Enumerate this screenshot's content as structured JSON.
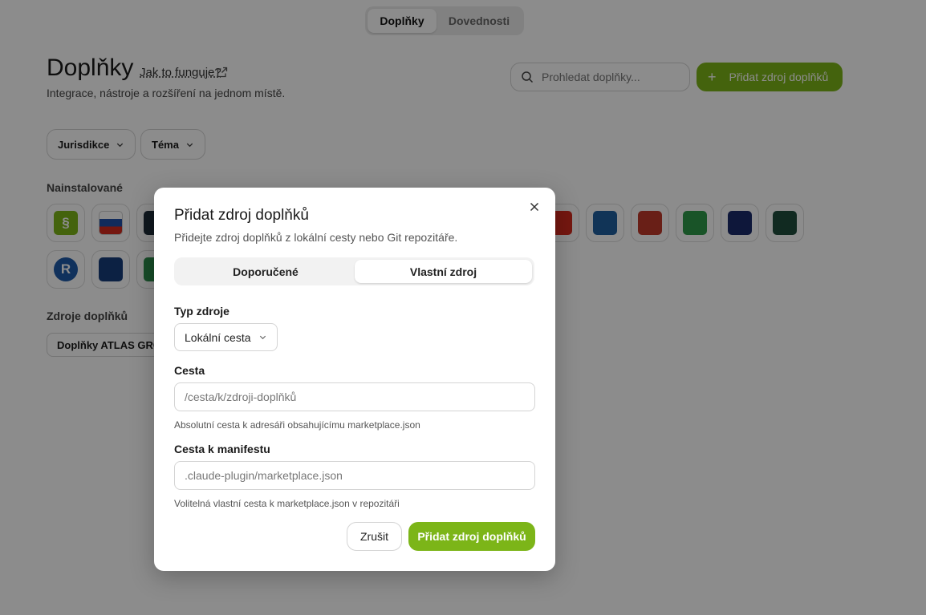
{
  "top_tabs": {
    "active": "Doplňky",
    "inactive": "Dovednosti"
  },
  "page": {
    "title": "Doplňky",
    "help_link": "Jak to funguje?",
    "subtitle": "Integrace, nástroje a rozšíření na jednom místě.",
    "search_placeholder": "Prohledat doplňky...",
    "add_source_label": "Přidat zdroj doplňků",
    "filters": {
      "jurisdiction": "Jurisdikce",
      "topic": "Téma"
    },
    "installed_label": "Nainstalované",
    "sources_label": "Zdroje doplňků",
    "source_chip": "Doplňky ATLAS GROUP"
  },
  "installed_icons": [
    {
      "name": "paragraph-icon",
      "glyph": "§",
      "color": "#7cb518"
    },
    {
      "name": "slovakia-flag-icon",
      "glyph": "",
      "color": "#ffffff"
    },
    {
      "name": "chart-icon",
      "glyph": "",
      "color": "#1e2d3a"
    },
    {
      "name": "flag-icon",
      "glyph": "",
      "color": "#d52b1e"
    },
    {
      "name": "bank-icon",
      "glyph": "",
      "color": "#1f5f9e"
    },
    {
      "name": "medical-house-icon",
      "glyph": "",
      "color": "#c0392b"
    },
    {
      "name": "map-pin-icon",
      "glyph": "",
      "color": "#2f9a4a"
    },
    {
      "name": "document-stamp-icon",
      "glyph": "",
      "color": "#1b2a6b"
    },
    {
      "name": "scales-search-icon",
      "glyph": "",
      "color": "#1f4e3d"
    },
    {
      "name": "registered-icon",
      "glyph": "",
      "color": "#1e5aa8"
    },
    {
      "name": "briefcase-icon",
      "glyph": "",
      "color": "#173d7a"
    },
    {
      "name": "green-app-icon",
      "glyph": "",
      "color": "#2a8a4a"
    }
  ],
  "dialog": {
    "title": "Přidat zdroj doplňků",
    "description": "Přidejte zdroj doplňků z lokální cesty nebo Git repozitáře.",
    "tabs": {
      "recommended": "Doporučené",
      "custom": "Vlastní zdroj"
    },
    "source_type_label": "Typ zdroje",
    "source_type_value": "Lokální cesta",
    "path_label": "Cesta",
    "path_placeholder": "/cesta/k/zdroji-doplňků",
    "path_hint": "Absolutní cesta k adresáři obsahujícímu marketplace.json",
    "manifest_label": "Cesta k manifestu",
    "manifest_placeholder": ".claude-plugin/marketplace.json",
    "manifest_hint": "Volitelná vlastní cesta k marketplace.json v repozitáři",
    "cancel_label": "Zrušit",
    "submit_label": "Přidat zdroj doplňků"
  },
  "colors": {
    "accent": "#7cb518",
    "overlay": "rgba(0,0,0,0.45)"
  }
}
